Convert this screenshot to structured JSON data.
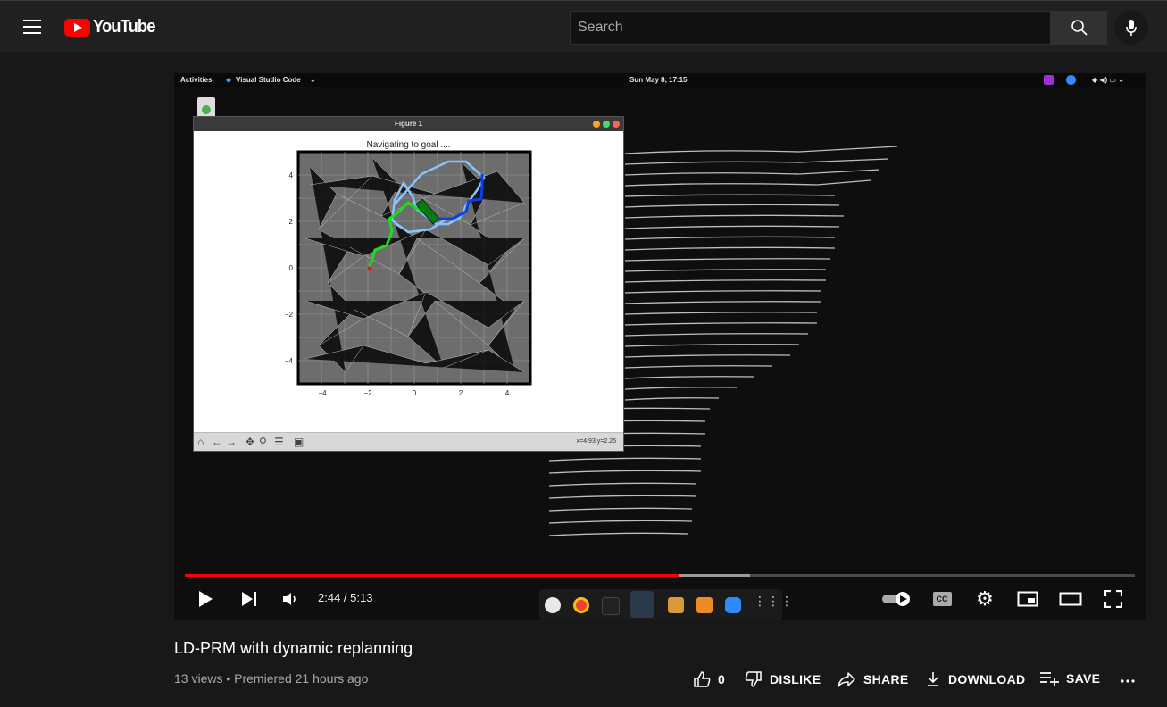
{
  "masthead": {
    "logo_text": "YouTube",
    "search_placeholder": "Search"
  },
  "video": {
    "desktop": {
      "activities": "Activities",
      "app_name": "Visual Studio Code",
      "clock": "Sun May  8, 17:15"
    },
    "figure": {
      "window_title": "Figure 1",
      "plot_title": "Navigating to goal ....",
      "x_ticks": [
        "−4",
        "−2",
        "0",
        "2",
        "4"
      ],
      "y_ticks": [
        "4",
        "2",
        "0",
        "−2",
        "−4"
      ],
      "coords": "x=4.93  y=2.25"
    },
    "current_time": "2:44 / 5:13",
    "progress_played_fraction": 0.52,
    "progress_buffered_fraction": 0.595,
    "controls": {
      "play_icon": "play-icon",
      "next_icon": "next-icon",
      "volume_icon": "volume-icon",
      "autoplay_icon": "autoplay-toggle-icon",
      "cc_label": "CC",
      "settings_icon": "gear-icon",
      "miniplayer_icon": "miniplayer-icon",
      "theater_icon": "theater-icon",
      "fullscreen_icon": "fullscreen-icon"
    }
  },
  "info": {
    "title": "LD-PRM with dynamic replanning",
    "meta": "13 views • Premiered 21 hours ago",
    "like_count": "0",
    "dislike_label": "DISLIKE",
    "share_label": "SHARE",
    "download_label": "DOWNLOAD",
    "save_label": "SAVE"
  },
  "colors": {
    "accent": "#ff0000",
    "background": "#181818",
    "masthead": "#202020"
  }
}
